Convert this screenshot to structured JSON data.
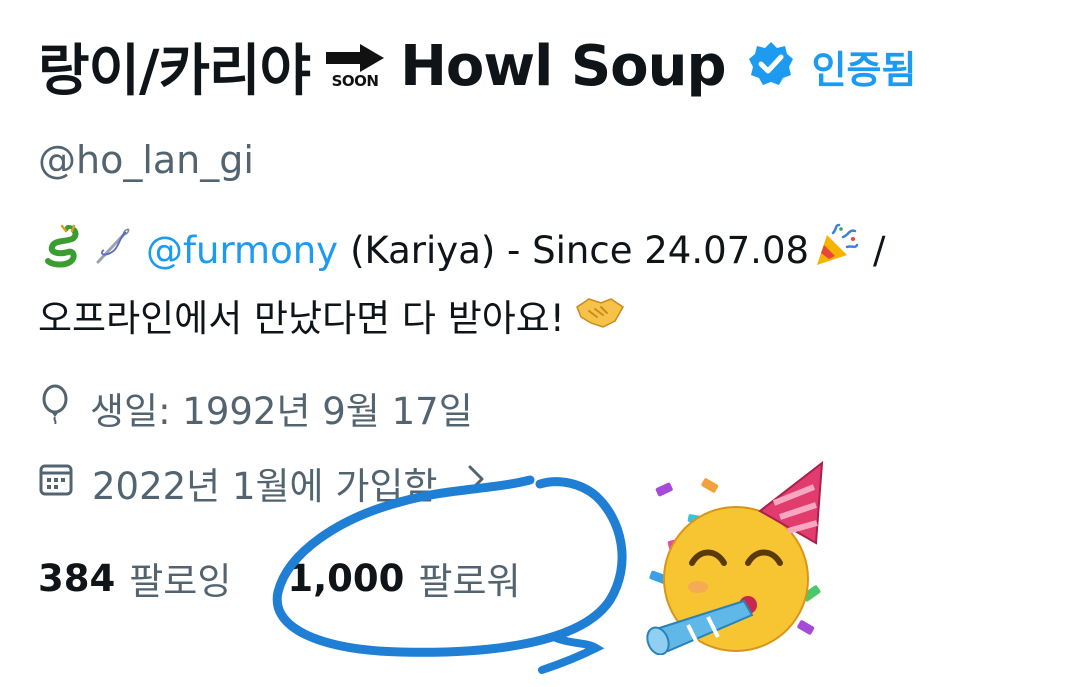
{
  "profile": {
    "name_part1": "랑이/카리야",
    "soon_badge": "SOON",
    "name_part2": "Howl Soup",
    "verified_label": "인증됨",
    "handle": "@ho_lan_gi",
    "bio_mention": "@furmony",
    "bio_line1_rest": "(Kariya) - Since 24.07.08",
    "bio_line1_slash": "/",
    "bio_line2": "오프라인에서 만났다면 다 받아요!",
    "birthday": "생일: 1992년 9월 17일",
    "joined": "2022년 1월에 가입함",
    "following_count": "384",
    "following_label": "팔로잉",
    "followers_count": "1,000",
    "followers_label": "팔로워"
  },
  "icons": {
    "verified": "verified-badge-icon",
    "soon": "soon-arrow-icon",
    "dragon": "dragon-emoji-icon",
    "needle": "sewing-needle-emoji-icon",
    "party": "party-popper-emoji-icon",
    "handshake": "handshake-emoji-icon",
    "birthday": "balloon-icon",
    "calendar": "calendar-icon",
    "chevron": "chevron-right-icon",
    "party_face": "partying-face-emoji-icon"
  },
  "colors": {
    "accent": "#1d9bf0",
    "text_primary": "#0f1419",
    "text_secondary": "#536471",
    "annotation": "#1e7fd4"
  }
}
